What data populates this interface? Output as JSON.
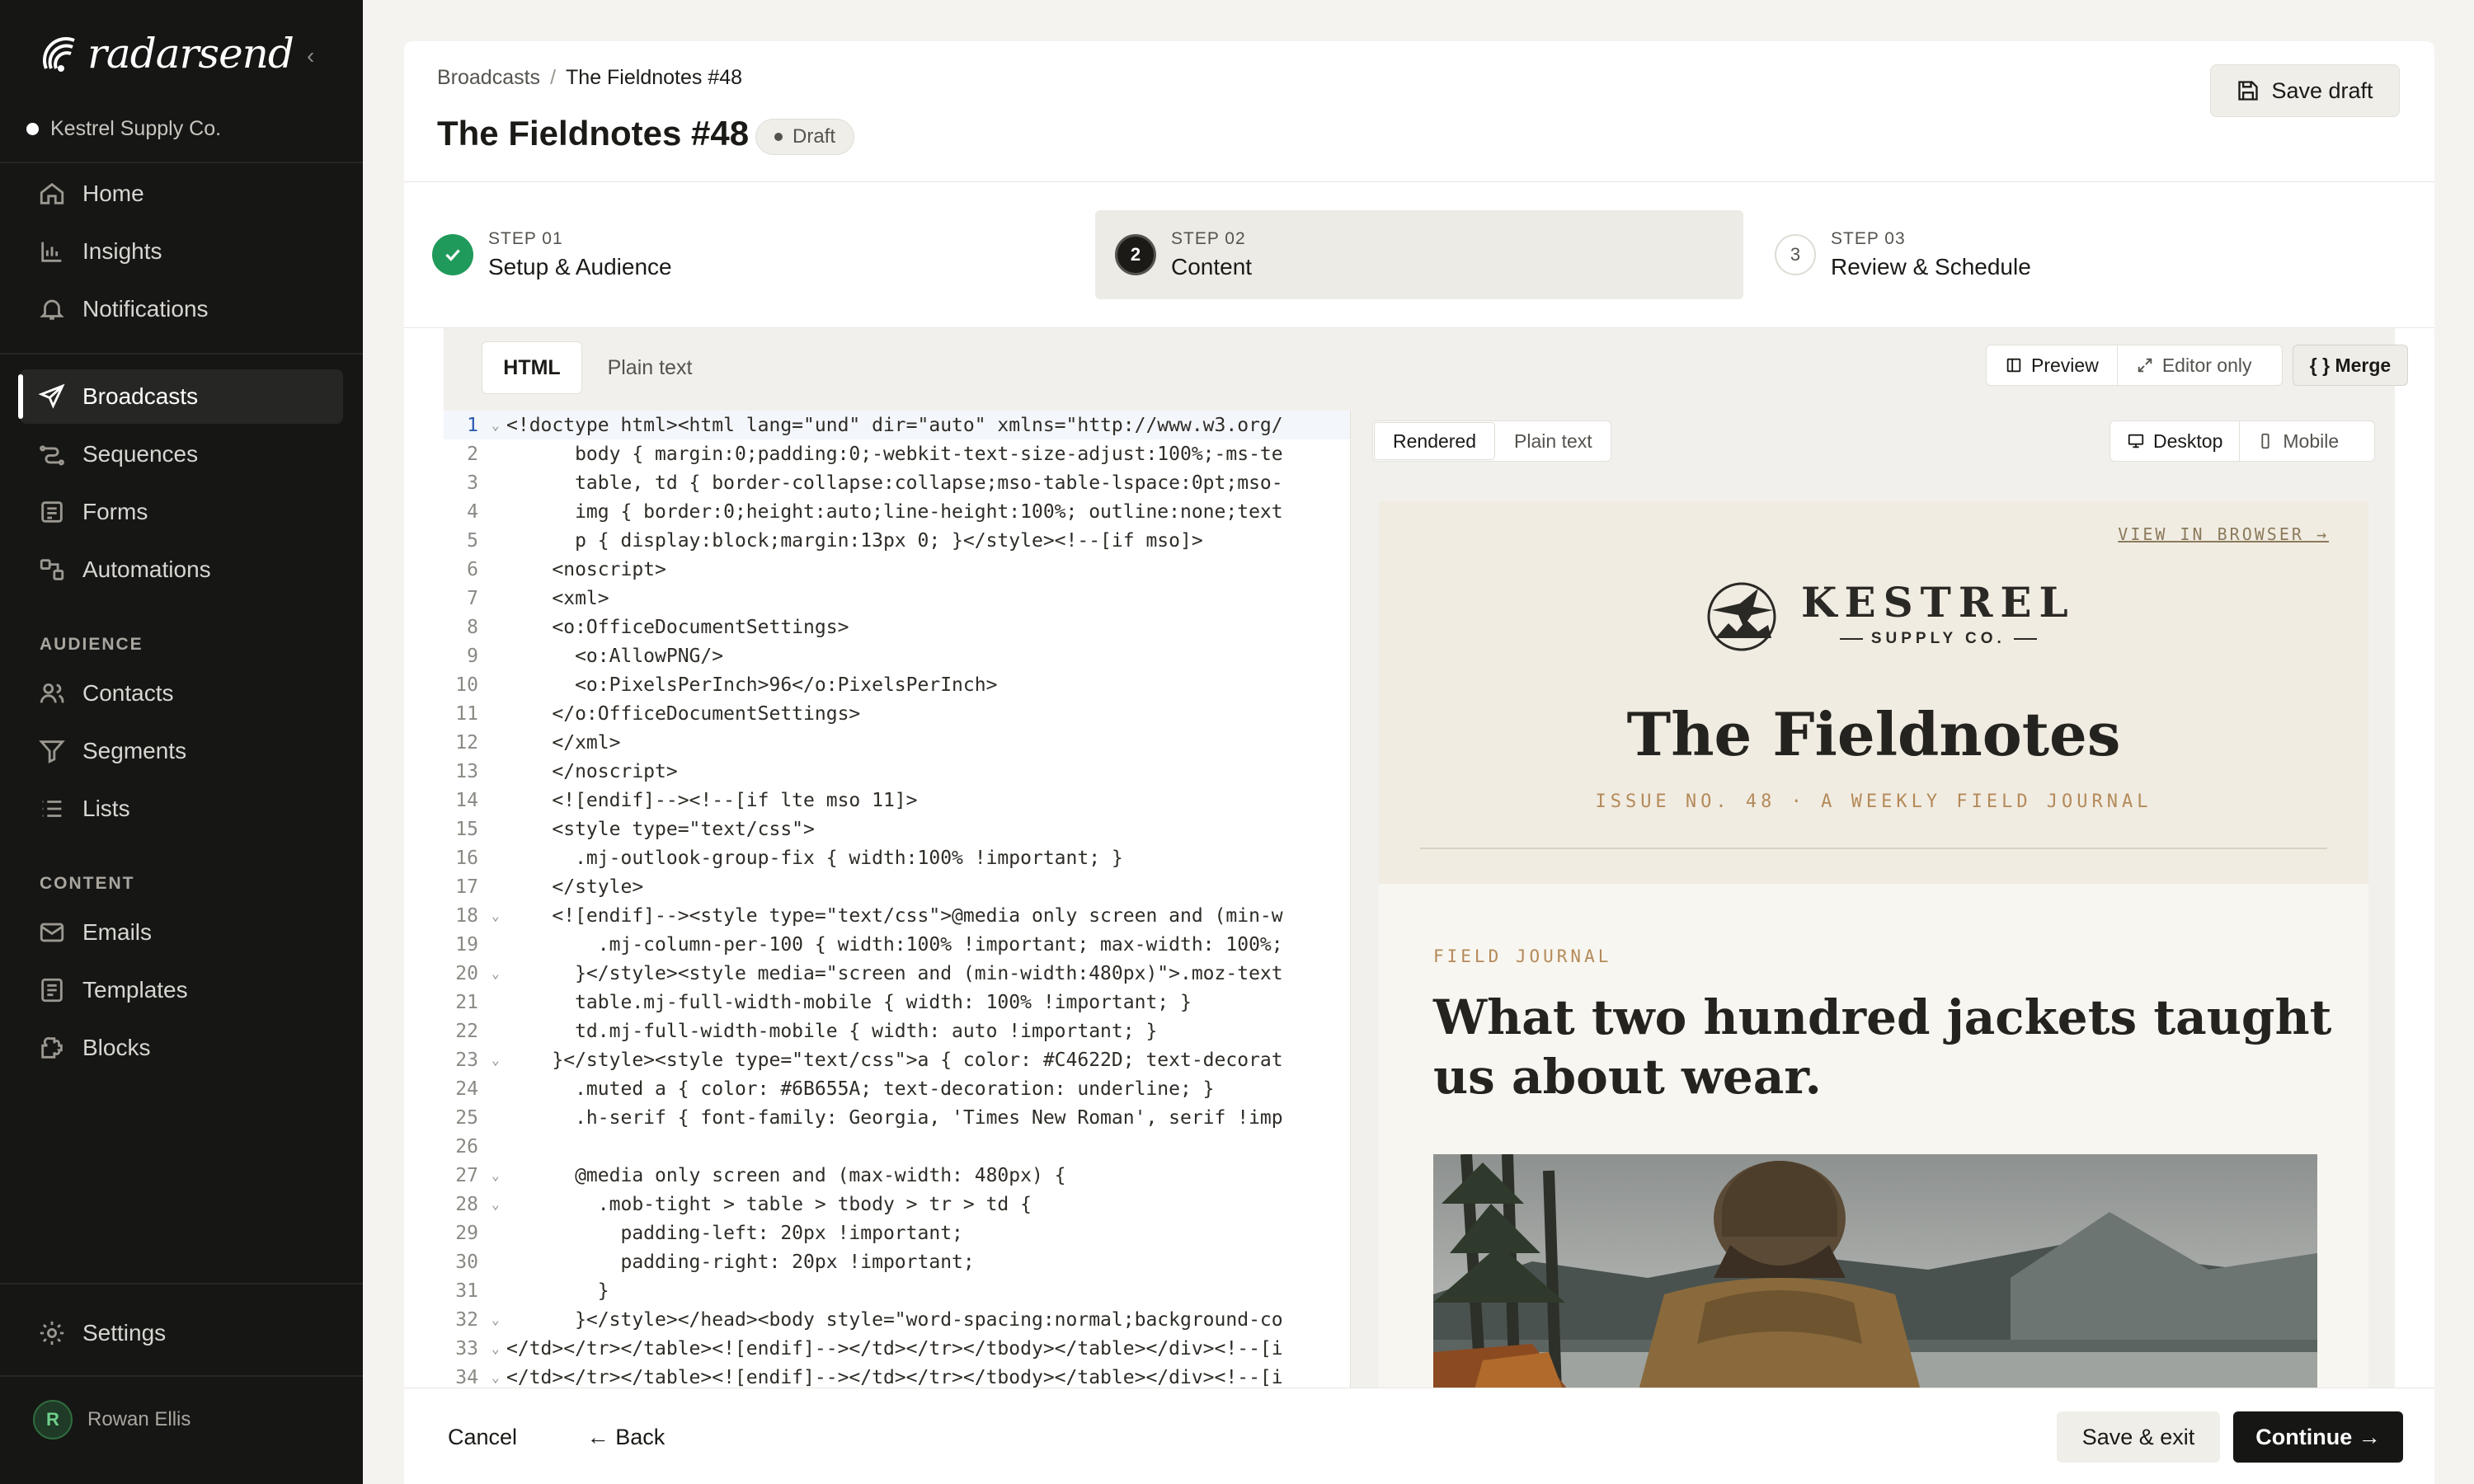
{
  "brand": {
    "name": "radarsend"
  },
  "org": "Kestrel Supply Co.",
  "nav": {
    "primary": [
      {
        "label": "Home",
        "icon": "home-icon"
      },
      {
        "label": "Insights",
        "icon": "chart-icon"
      },
      {
        "label": "Notifications",
        "icon": "bell-icon"
      }
    ],
    "messaging": [
      {
        "label": "Broadcasts",
        "icon": "send-icon",
        "active": true
      },
      {
        "label": "Sequences",
        "icon": "sequence-icon"
      },
      {
        "label": "Forms",
        "icon": "form-icon"
      },
      {
        "label": "Automations",
        "icon": "automation-icon"
      }
    ],
    "audience_label": "AUDIENCE",
    "audience": [
      {
        "label": "Contacts",
        "icon": "users-icon"
      },
      {
        "label": "Segments",
        "icon": "filter-icon"
      },
      {
        "label": "Lists",
        "icon": "list-icon"
      }
    ],
    "content_label": "CONTENT",
    "content": [
      {
        "label": "Emails",
        "icon": "mail-icon"
      },
      {
        "label": "Templates",
        "icon": "template-icon"
      },
      {
        "label": "Blocks",
        "icon": "blocks-icon"
      }
    ],
    "settings": "Settings"
  },
  "user": {
    "initial": "R",
    "name": "Rowan Ellis"
  },
  "header": {
    "breadcrumb": [
      "Broadcasts",
      "The Fieldnotes #48"
    ],
    "title": "The Fieldnotes #48",
    "status": "Draft",
    "save_draft": "Save draft"
  },
  "steps": [
    {
      "num": "STEP 01",
      "label": "Setup & Audience",
      "state": "done"
    },
    {
      "num": "STEP 02",
      "label": "Content",
      "state": "active",
      "index": "2"
    },
    {
      "num": "STEP 03",
      "label": "Review & Schedule",
      "state": "todo",
      "index": "3"
    }
  ],
  "editor": {
    "tabs": [
      "HTML",
      "Plain text"
    ],
    "tools": [
      "Preview",
      "Editor only"
    ],
    "merge": "{ } Merge",
    "code_lines": [
      "<!doctype html><html lang=\"und\" dir=\"auto\" xmlns=\"http://www.w3.org/",
      "      body { margin:0;padding:0;-webkit-text-size-adjust:100%;-ms-te",
      "      table, td { border-collapse:collapse;mso-table-lspace:0pt;mso-",
      "      img { border:0;height:auto;line-height:100%; outline:none;text",
      "      p { display:block;margin:13px 0; }</style><!--[if mso]>",
      "    <noscript>",
      "    <xml>",
      "    <o:OfficeDocumentSettings>",
      "      <o:AllowPNG/>",
      "      <o:PixelsPerInch>96</o:PixelsPerInch>",
      "    </o:OfficeDocumentSettings>",
      "    </xml>",
      "    </noscript>",
      "    <![endif]--><!--[if lte mso 11]>",
      "    <style type=\"text/css\">",
      "      .mj-outlook-group-fix { width:100% !important; }",
      "    </style>",
      "    <![endif]--><style type=\"text/css\">@media only screen and (min-w",
      "        .mj-column-per-100 { width:100% !important; max-width: 100%;",
      "      }</style><style media=\"screen and (min-width:480px)\">.moz-text",
      "      table.mj-full-width-mobile { width: 100% !important; }",
      "      td.mj-full-width-mobile { width: auto !important; }",
      "    }</style><style type=\"text/css\">a { color: #C4622D; text-decorat",
      "      .muted a { color: #6B655A; text-decoration: underline; }",
      "      .h-serif { font-family: Georgia, 'Times New Roman', serif !imp",
      "",
      "      @media only screen and (max-width: 480px) {",
      "        .mob-tight > table > tbody > tr > td {",
      "          padding-left: 20px !important;",
      "          padding-right: 20px !important;",
      "        }",
      "      }</style></head><body style=\"word-spacing:normal;background-co",
      "</td></tr></table><![endif]--></td></tr></tbody></table></div><!--[i",
      "</td></tr></table><![endif]--></td></tr></tbody></table></div><!--[i"
    ],
    "fold_lines": [
      1,
      18,
      20,
      23,
      27,
      28,
      32,
      33,
      34
    ]
  },
  "preview": {
    "tabs": [
      "Rendered",
      "Plain text"
    ],
    "devices": [
      "Desktop",
      "Mobile"
    ],
    "email": {
      "view_in_browser": "VIEW IN BROWSER →",
      "logo_name": "KESTREL",
      "logo_sub": "SUPPLY CO.",
      "title": "The Fieldnotes",
      "issue": "ISSUE NO. 48 · A WEEKLY FIELD JOURNAL",
      "kicker": "FIELD JOURNAL",
      "headline": "What two hundred jackets taught us about wear."
    }
  },
  "footer": {
    "cancel": "Cancel",
    "back": "← Back",
    "save_exit": "Save & exit",
    "continue": "Continue →"
  }
}
